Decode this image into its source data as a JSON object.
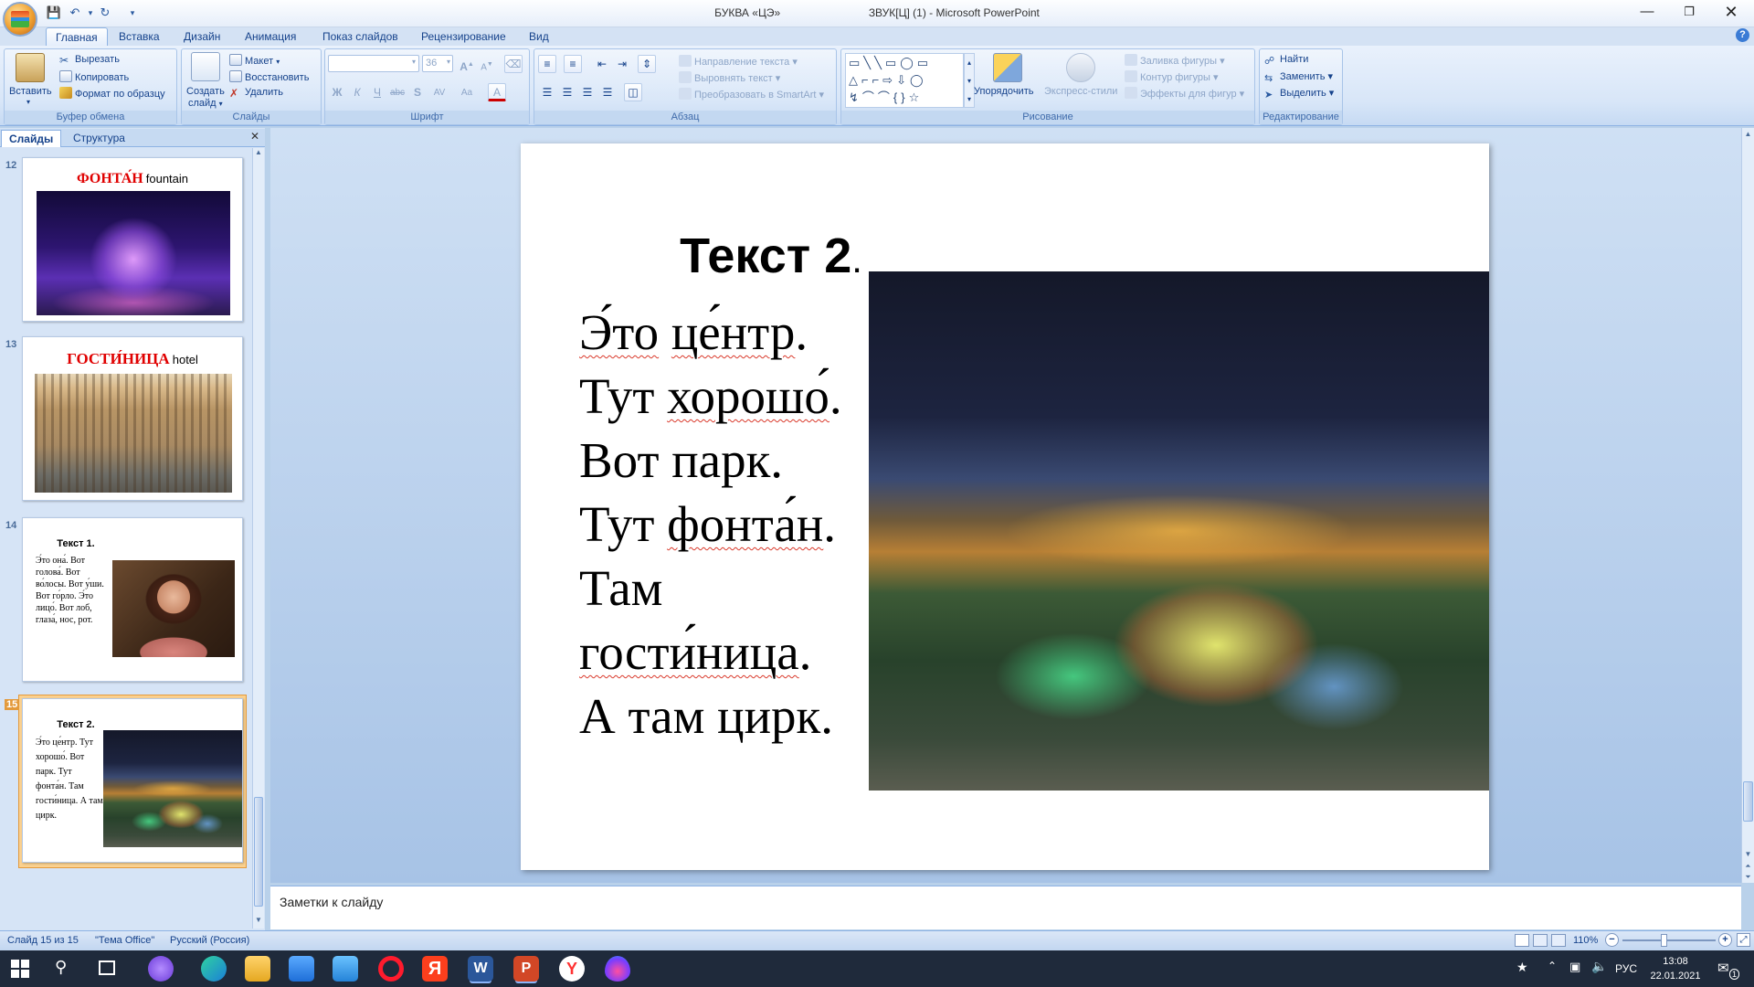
{
  "window": {
    "title_doc": "БУКВА «ЦЭ»",
    "title_main": "ЗВУК[Ц] (1) - Microsoft PowerPoint"
  },
  "tabs": [
    "Главная",
    "Вставка",
    "Дизайн",
    "Анимация",
    "Показ слайдов",
    "Рецензирование",
    "Вид"
  ],
  "ribbon": {
    "clipboard": {
      "paste": "Вставить",
      "cut": "Вырезать",
      "copy": "Копировать",
      "format_painter": "Формат по образцу",
      "label": "Буфер обмена"
    },
    "slides": {
      "new_slide_1": "Создать",
      "new_slide_2": "слайд",
      "layout": "Макет",
      "reset": "Восстановить",
      "delete": "Удалить",
      "label": "Слайды"
    },
    "font": {
      "size": "36",
      "label": "Шрифт"
    },
    "paragraph": {
      "text_direction": "Направление текста",
      "align_text": "Выровнять текст",
      "smartart": "Преобразовать в SmartArt",
      "label": "Абзац"
    },
    "drawing": {
      "arrange": "Упорядочить",
      "quick_styles": "Экспресс-стили",
      "shape_fill": "Заливка фигуры",
      "shape_outline": "Контур фигуры",
      "shape_effects": "Эффекты для фигур",
      "label": "Рисование"
    },
    "editing": {
      "find": "Найти",
      "replace": "Заменить",
      "select": "Выделить",
      "label": "Редактирование"
    }
  },
  "pane_tabs": {
    "slides": "Слайды",
    "outline": "Структура"
  },
  "thumbnails": [
    {
      "num": "12",
      "title": "ФОНТА́Н",
      "sub": "fountain"
    },
    {
      "num": "13",
      "title": "ГОСТИ́НИЦА",
      "sub": "hotel"
    },
    {
      "num": "14",
      "title": "Текст 1.",
      "body": "Э́то она́. Вот голова́. Вот во́лосы. Вот у́ши. Вот го́рло. Э́то лицо́. Вот лоб, глаза́, нос, рот."
    },
    {
      "num": "15",
      "title": "Текст 2.",
      "body": "Э́то це́нтр. Тут хорошо́. Вот парк. Тут фонта́н. Там гости́ница. А там цирк."
    }
  ],
  "slide": {
    "title": "Текст 2",
    "title_dot": ".",
    "lines": [
      "Э́то",
      "це́нтр",
      ".",
      "Тут",
      "хорошо́",
      ".",
      "Вот парк.",
      "Тут",
      "фонта́н",
      ".",
      "Там",
      "гости́ница",
      ".",
      "А там цирк."
    ]
  },
  "notes_placeholder": "Заметки к слайду",
  "status": {
    "slide_count": "Слайд 15 из 15",
    "theme": "\"Тема Office\"",
    "language": "Русский (Россия)",
    "zoom": "110%"
  },
  "taskbar": {
    "lang": "РУС",
    "time": "13:08",
    "date": "22.01.2021",
    "notif": "1"
  }
}
